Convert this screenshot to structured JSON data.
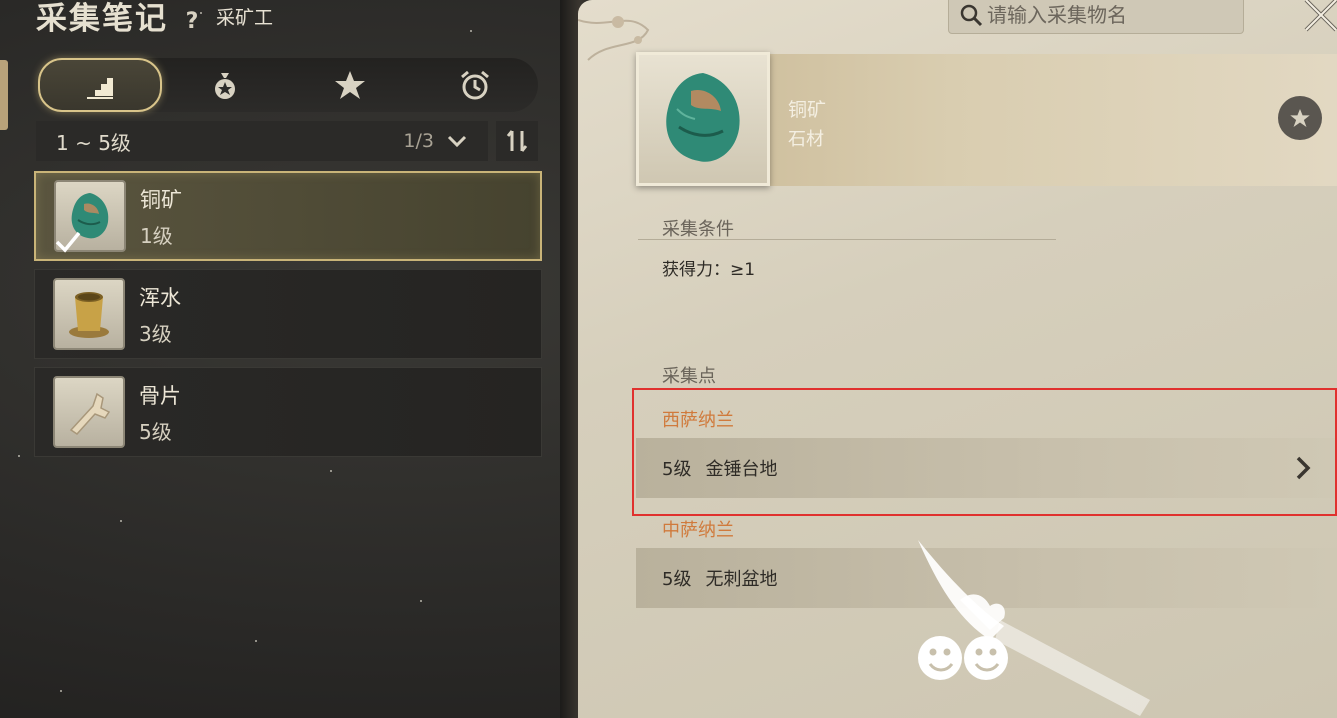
{
  "header": {
    "title": "采集笔记",
    "help_symbol": "?",
    "profession": "采矿工"
  },
  "tabs": [
    {
      "name": "level-tab",
      "icon": "stairs-icon",
      "active": true
    },
    {
      "name": "bag-tab",
      "icon": "money-bag-icon",
      "active": false
    },
    {
      "name": "favorite-tab",
      "icon": "star-icon",
      "active": false
    },
    {
      "name": "alarm-tab",
      "icon": "alarm-clock-icon",
      "active": false
    }
  ],
  "filter": {
    "level_range": "1 ~ 5级",
    "page": "1/3"
  },
  "items": [
    {
      "name": "铜矿",
      "level": "1级",
      "icon": "copper-ore-icon",
      "selected": true
    },
    {
      "name": "浑水",
      "level": "3级",
      "icon": "muddy-water-cup-icon",
      "selected": false
    },
    {
      "name": "骨片",
      "level": "5级",
      "icon": "bone-fragment-icon",
      "selected": false
    }
  ],
  "search": {
    "placeholder": "请输入采集物名"
  },
  "detail": {
    "name": "铜矿",
    "category": "石材",
    "conditions_label": "采集条件",
    "condition": "获得力：≥1",
    "points_label": "采集点",
    "regions": [
      {
        "region": "西萨纳兰",
        "level": "5级",
        "place": "金锤台地"
      },
      {
        "region": "中萨纳兰",
        "level": "5级",
        "place": "无刺盆地"
      }
    ]
  },
  "colors": {
    "accent_gold": "#c9b478",
    "region_orange": "#d07a3c",
    "highlight_red": "#e0312e"
  }
}
